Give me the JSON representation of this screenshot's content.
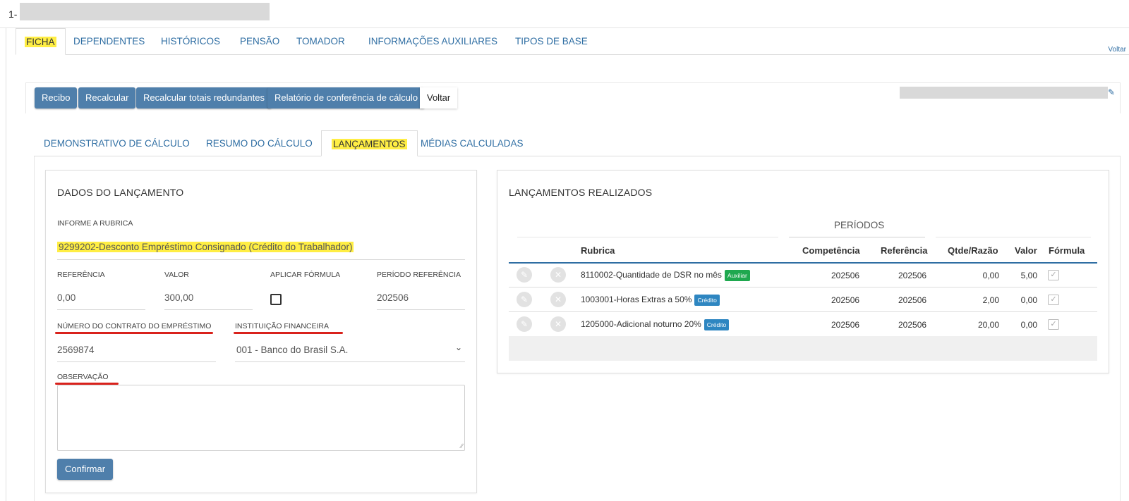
{
  "header": {
    "title_prefix": "1-"
  },
  "main_tabs": [
    {
      "label": "FICHA"
    },
    {
      "label": "DEPENDENTES"
    },
    {
      "label": "HISTÓRICOS"
    },
    {
      "label": "PENSÃO"
    },
    {
      "label": "TOMADOR"
    },
    {
      "label": "INFORMAÇÕES AUXILIARES"
    },
    {
      "label": "TIPOS DE BASE"
    }
  ],
  "voltar_top": "Voltar",
  "toolbar": {
    "recibo": "Recibo",
    "recalcular": "Recalcular",
    "recalcular_totais": "Recalcular totais redundantes",
    "relatorio": "Relatório de conferência de cálculo",
    "voltar": "Voltar"
  },
  "sub_tabs": [
    {
      "label": "DEMONSTRATIVO DE CÁLCULO"
    },
    {
      "label": "RESUMO DO CÁLCULO"
    },
    {
      "label": "LANÇAMENTOS"
    },
    {
      "label": "MÉDIAS CALCULADAS"
    }
  ],
  "form": {
    "title": "DADOS DO LANÇAMENTO",
    "rubrica_label": "INFORME A RUBRICA",
    "rubrica_value": "9299202-Desconto Empréstimo Consignado (Crédito do Trabalhador)",
    "referencia_label": "REFERÊNCIA",
    "referencia_value": "0,00",
    "valor_label": "VALOR",
    "valor_value": "300,00",
    "aplicar_formula_label": "APLICAR FÓRMULA",
    "periodo_label": "PERÍODO REFERÊNCIA",
    "periodo_value": "202506",
    "contrato_label": "NÚMERO DO CONTRATO DO EMPRÉSTIMO",
    "contrato_value": "2569874",
    "instituicao_label": "INSTITUIÇÃO FINANCEIRA",
    "instituicao_value": "001 - Banco do Brasil S.A.",
    "observacao_label": "OBSERVAÇÃO",
    "confirm_label": "Confirmar"
  },
  "lancamentos": {
    "title": "LANÇAMENTOS REALIZADOS",
    "periodos_label": "PERÍODOS",
    "columns": {
      "rubrica": "Rubrica",
      "competencia": "Competência",
      "referencia": "Referência",
      "qtde": "Qtde/Razão",
      "valor": "Valor",
      "formula": "Fórmula"
    },
    "rows": [
      {
        "rubrica": "8110002-Quantidade de DSR no mês",
        "badge": "Auxiliar",
        "competencia": "202506",
        "referencia": "202506",
        "qtde": "0,00",
        "valor": "5,00"
      },
      {
        "rubrica": "1003001-Horas Extras a 50%",
        "badge": "Crédito",
        "competencia": "202506",
        "referencia": "202506",
        "qtde": "2,00",
        "valor": "0,00"
      },
      {
        "rubrica": "1205000-Adicional noturno 20%",
        "badge": "Crédito",
        "competencia": "202506",
        "referencia": "202506",
        "qtde": "20,00",
        "valor": "0,00"
      }
    ]
  },
  "colors": {
    "accent": "#4f7fab",
    "link": "#2f6ea3",
    "highlight": "#ffee44",
    "underline_red": "#d9221c",
    "badge_auxiliar": "#1fa84f",
    "badge_credito": "#2e86c1"
  }
}
